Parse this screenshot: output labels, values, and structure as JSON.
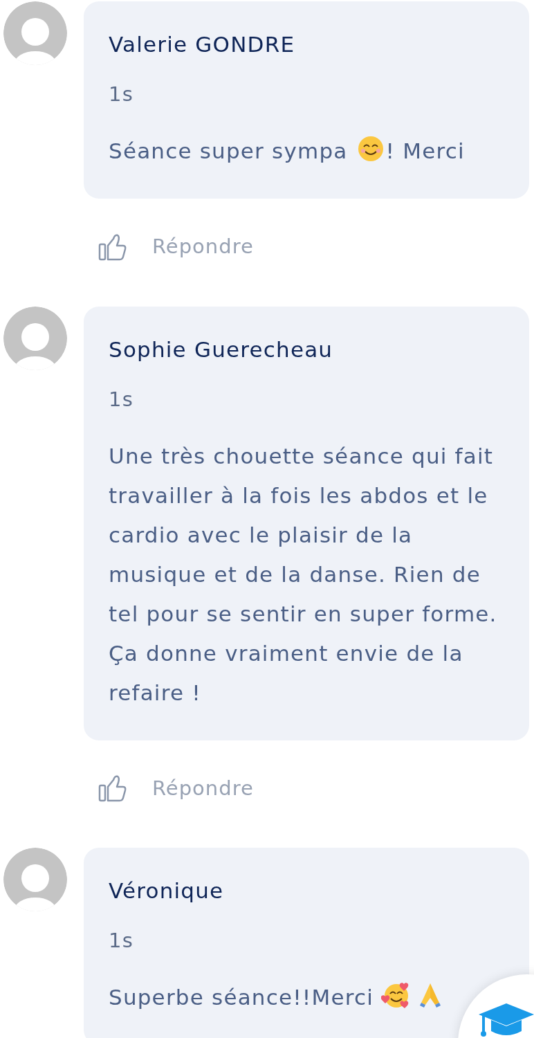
{
  "comments": [
    {
      "author": "Valerie GONDRE",
      "time": "1s",
      "message": [
        {
          "kind": "text",
          "text": "Séance super sympa "
        },
        {
          "kind": "smile"
        },
        {
          "kind": "text",
          "text": "! Merci"
        }
      ],
      "reply": "Répondre"
    },
    {
      "author": "Sophie Guerecheau",
      "time": "1s",
      "message": [
        {
          "kind": "text",
          "text": "Une très chouette séance qui fait travailler à la fois les abdos et le cardio avec le plaisir de la musique et de la danse. Rien de tel pour se sentir en super forme. Ça donne vraiment envie de la refaire !"
        }
      ],
      "reply": "Répondre"
    },
    {
      "author": "Véronique",
      "time": "1s",
      "message": [
        {
          "kind": "text",
          "text": "Superbe séance!!Merci "
        },
        {
          "kind": "hearts"
        },
        {
          "kind": "pray"
        }
      ]
    }
  ]
}
